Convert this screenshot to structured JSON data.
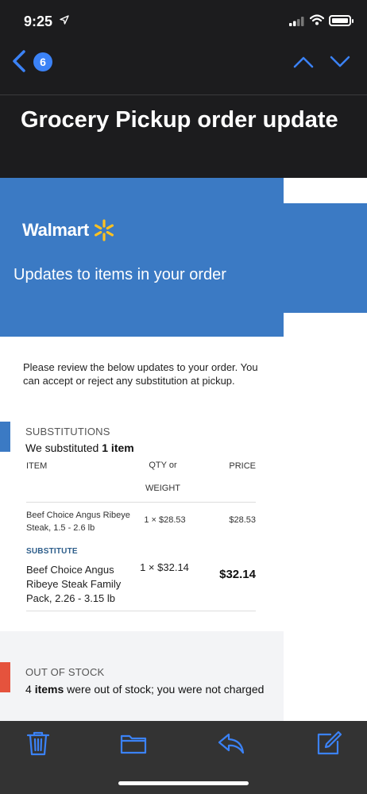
{
  "status_bar": {
    "time": "9:25",
    "icons": [
      "location-arrow-icon",
      "cellular-signal-icon",
      "wifi-icon",
      "battery-icon"
    ]
  },
  "nav": {
    "unread_count": "6",
    "icons": [
      "back-chevron-icon",
      "chevron-up-icon",
      "chevron-down-icon"
    ],
    "accent_color": "#3b82f6"
  },
  "email": {
    "subject": "Grocery Pickup order update",
    "brand": {
      "name": "Walmart",
      "spark_color": "#ffc220",
      "banner_color": "#3b7ac4"
    },
    "headline": "Updates to items in your order",
    "intro": "Please review the below updates to your order. You can accept or reject any substitution at pickup.",
    "substitutions": {
      "section_label": "SUBSTITUTIONS",
      "summary_prefix": "We substituted ",
      "summary_bold": "1 item",
      "columns": {
        "item": "ITEM",
        "qty": "QTY or WEIGHT",
        "price": "PRICE"
      },
      "original": {
        "name": "Beef Choice Angus Ribeye Steak, 1.5 - 2.6 lb",
        "qty": "1 × $28.53",
        "price": "$28.53"
      },
      "substitute_label": "SUBSTITUTE",
      "substitute": {
        "name": "Beef Choice Angus Ribeye Steak Family Pack, 2.26 - 3.15 lb",
        "qty": "1 × $32.14",
        "price": "$32.14"
      },
      "accent_color": "#3b7ac4"
    },
    "out_of_stock": {
      "section_label": "OUT OF STOCK",
      "count": "4",
      "count_word": "items",
      "summary_rest": " were out of stock; you were not charged",
      "accent_color": "#e5533d"
    }
  },
  "toolbar": {
    "icons": [
      "trash-icon",
      "folder-icon",
      "reply-icon",
      "compose-icon"
    ],
    "icon_color": "#3b82f6"
  }
}
